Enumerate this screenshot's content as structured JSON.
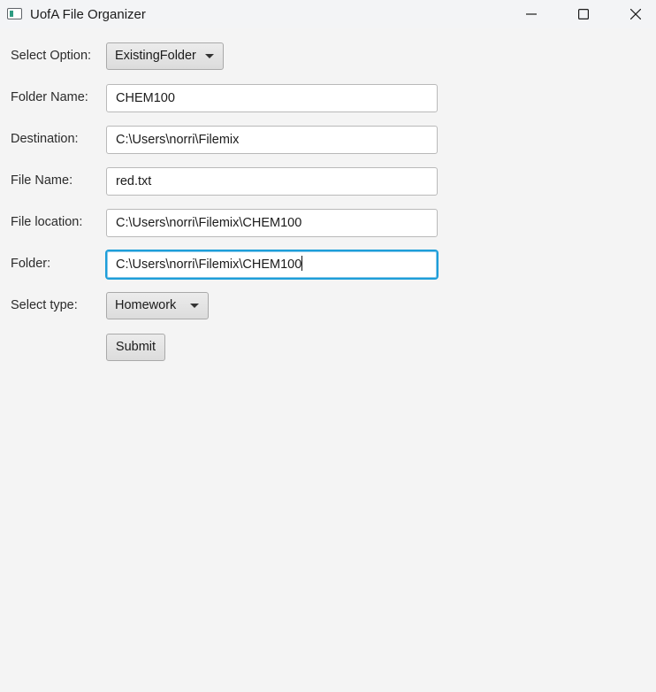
{
  "window": {
    "title": "UofA File Organizer",
    "icon": "app-window-icon",
    "controls": [
      "minimize-icon",
      "maximize-icon",
      "close-icon"
    ]
  },
  "form": {
    "select_option": {
      "label": "Select Option:",
      "value": "ExistingFolder"
    },
    "folder_name": {
      "label": "Folder Name:",
      "value": "CHEM100"
    },
    "destination": {
      "label": "Destination:",
      "value": "C:\\Users\\norri\\Filemix"
    },
    "file_name": {
      "label": "File Name:",
      "value": "red.txt"
    },
    "file_location": {
      "label": "File location:",
      "value": "C:\\Users\\norri\\Filemix\\CHEM100"
    },
    "folder": {
      "label": "Folder:",
      "value": "C:\\Users\\norri\\Filemix\\CHEM100"
    },
    "select_type": {
      "label": "Select type:",
      "value": "Homework"
    },
    "submit_label": "Submit"
  },
  "colors": {
    "background": "#f4f4f4",
    "focus_ring": "#1d9ed9",
    "icon_accent": "#2f9c82"
  }
}
